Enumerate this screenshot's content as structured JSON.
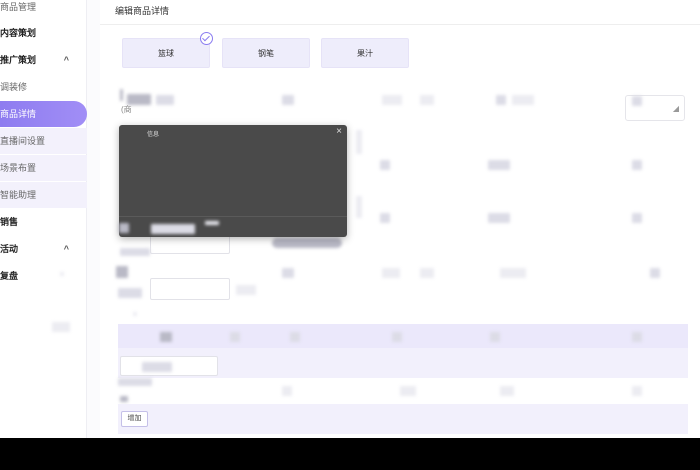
{
  "sidebar": {
    "items": [
      {
        "label": "商品管理",
        "kind": "sub"
      },
      {
        "label": "内容策划",
        "kind": "group"
      },
      {
        "label": "推广策划",
        "kind": "group"
      },
      {
        "label": "调装修",
        "kind": "sub"
      },
      {
        "label": "商品详情",
        "kind": "active"
      },
      {
        "label": "直播间设置",
        "kind": "sub"
      },
      {
        "label": "场景布置",
        "kind": "sub"
      },
      {
        "label": "智能助理",
        "kind": "sub"
      },
      {
        "label": "销售",
        "kind": "group"
      },
      {
        "label": "活动",
        "kind": "group"
      },
      {
        "label": "复盘",
        "kind": "group"
      }
    ],
    "chevron_up": "^"
  },
  "header": {
    "title": "编辑商品详情"
  },
  "tags": [
    "篮球",
    "钢笔",
    "果汁"
  ],
  "modal": {
    "title": "信息",
    "close_glyph": "×"
  },
  "form": {
    "small_label": "(商",
    "add_label": "增加"
  },
  "colors": {
    "accent": "#8e7cf0",
    "tag_bg": "#eeedfb",
    "modal_bg": "#4a4a4a"
  }
}
